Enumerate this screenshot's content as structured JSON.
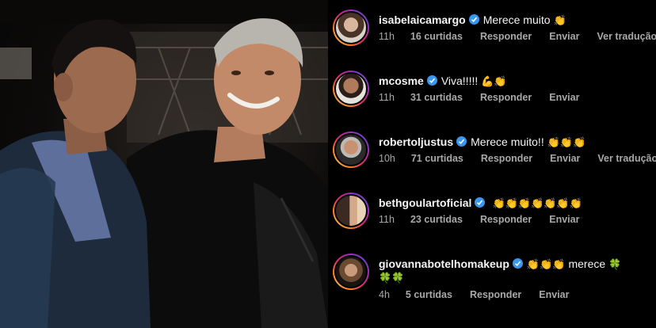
{
  "comments": [
    {
      "username": "isabelaicamargo",
      "text": "Merece muito",
      "emoji": "👏",
      "time": "11h",
      "likes": "16 curtidas",
      "reply": "Responder",
      "send": "Enviar",
      "translate": "Ver tradução"
    },
    {
      "username": "mcosme",
      "text": "Viva!!!!!",
      "emoji": "💪👏",
      "time": "11h",
      "likes": "31 curtidas",
      "reply": "Responder",
      "send": "Enviar"
    },
    {
      "username": "robertoljustus",
      "text": "Merece muito!!",
      "emoji": "👏👏👏",
      "time": "10h",
      "likes": "71 curtidas",
      "reply": "Responder",
      "send": "Enviar",
      "translate": "Ver tradução"
    },
    {
      "username": "bethgoulartoficial",
      "text": "",
      "emoji": "👏👏👏👏👏👏👏",
      "time": "11h",
      "likes": "23 curtidas",
      "reply": "Responder",
      "send": "Enviar"
    },
    {
      "username": "giovannabotelhomakeup",
      "text": "merece",
      "emoji_before": "👏👏👏",
      "emoji_after": "🍀",
      "emoji_line2": "🍀🍀",
      "time": "4h",
      "likes": "5 curtidas",
      "reply": "Responder",
      "send": "Enviar"
    }
  ],
  "colors": {
    "background": "#000000",
    "text_primary": "#f5f5f5",
    "text_secondary": "#a8a8a8",
    "verified_badge": "#3897f0"
  }
}
